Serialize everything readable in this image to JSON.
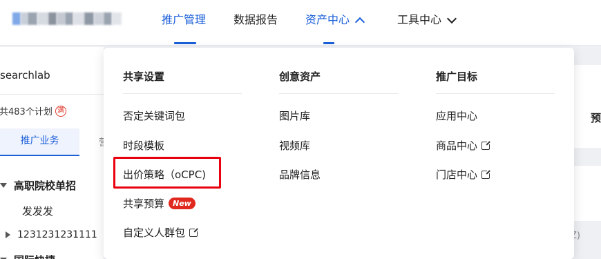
{
  "topnav": {
    "items": [
      {
        "label": "推广管理",
        "active": true
      },
      {
        "label": "数据报告",
        "active": false
      },
      {
        "label": "资产中心",
        "active": true,
        "chevron": "up"
      },
      {
        "label": "工具中心",
        "active": false,
        "chevron": "down"
      }
    ]
  },
  "leftpanel": {
    "account": "searchlab",
    "plan_count": "共483个计划",
    "plan_badge": "满",
    "tab_active": "推广业务",
    "tab_other": "营",
    "tree": [
      {
        "label": "高职院校单招",
        "expanded": true
      },
      {
        "label": "发发发"
      },
      {
        "label": "1231231231111",
        "expanded": false
      },
      {
        "label": "国际快捷"
      }
    ]
  },
  "dropdown": {
    "columns": [
      {
        "heading": "共享设置",
        "items": [
          {
            "label": "否定关键词包"
          },
          {
            "label": "时段模板"
          },
          {
            "label": "出价策略（oCPC)",
            "highlighted": true
          },
          {
            "label": "共享预算",
            "badge": "New"
          },
          {
            "label": "自定义人群包",
            "external": true
          }
        ]
      },
      {
        "heading": "创意资产",
        "items": [
          {
            "label": "图片库"
          },
          {
            "label": "视频库"
          },
          {
            "label": "品牌信息"
          }
        ]
      },
      {
        "heading": "推广目标",
        "items": [
          {
            "label": "应用中心"
          },
          {
            "label": "商品中心",
            "external": true
          },
          {
            "label": "门店中心",
            "external": true
          }
        ]
      }
    ]
  },
  "right": {
    "glyph": "预",
    "paren": "Ż)"
  },
  "colors": {
    "accent": "#1b5fd9",
    "highlight_box": "#e8000f",
    "new_badge": "#e1281f"
  }
}
